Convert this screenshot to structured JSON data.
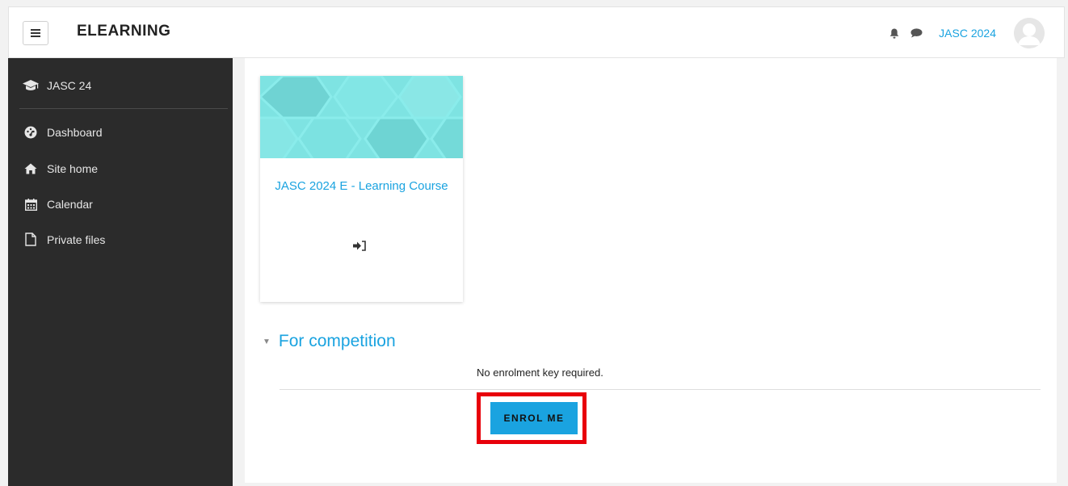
{
  "navbar": {
    "brand": "ELEARNING",
    "user_name": "JASC 2024"
  },
  "sidebar": {
    "course": "JASC 24",
    "items": [
      {
        "label": "Dashboard",
        "icon": "dashboard-icon"
      },
      {
        "label": "Site home",
        "icon": "home-icon"
      },
      {
        "label": "Calendar",
        "icon": "calendar-icon"
      },
      {
        "label": "Private files",
        "icon": "file-icon"
      }
    ]
  },
  "course_card": {
    "title": "JASC 2024 E - Learning Course",
    "icon": "enrol-sign-in-icon"
  },
  "enrolment": {
    "section_title": "For competition",
    "note": "No enrolment key required.",
    "button_label": "ENROL ME"
  },
  "colors": {
    "accent": "#1aa3e0",
    "sidebar_bg": "#2b2b2b",
    "highlight": "#e8000b"
  }
}
